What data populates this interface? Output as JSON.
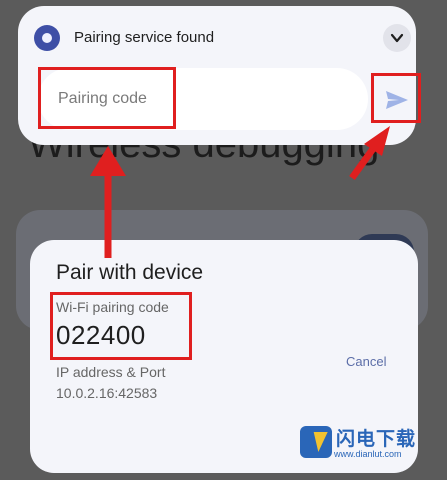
{
  "background": {
    "title": "Wireless debugging",
    "cancel_label": "Cancel"
  },
  "notification": {
    "app_icon": "pairing-service-icon",
    "title": "Pairing service found",
    "expand_icon": "chevron-down-icon",
    "input": {
      "placeholder": "Pairing code",
      "value": ""
    },
    "send_icon": "send-icon"
  },
  "dialog": {
    "title": "Pair with device",
    "wifi_code_label": "Wi-Fi pairing code",
    "wifi_code": "022400",
    "ip_label": "IP address & Port",
    "ip_value": "10.0.2.16:42583"
  },
  "watermark": {
    "name": "闪电下载",
    "url": "www.dianlut.com"
  },
  "colors": {
    "highlight": "#e01f1f",
    "accent": "#3e4fa6",
    "send_icon": "#9fb3e6"
  }
}
